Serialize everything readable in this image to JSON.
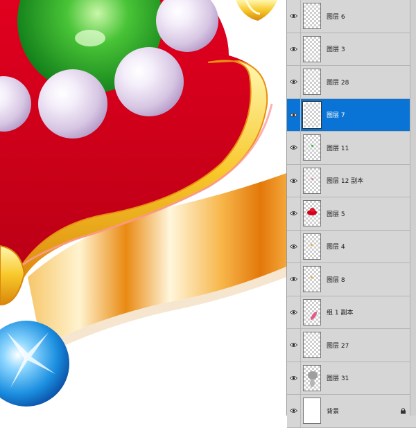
{
  "layers": [
    {
      "name": "图层 6",
      "selected": false,
      "thumb": "empty"
    },
    {
      "name": "图层 3",
      "selected": false,
      "thumb": "empty"
    },
    {
      "name": "图层 28",
      "selected": false,
      "thumb": "empty"
    },
    {
      "name": "图层 7",
      "selected": true,
      "thumb": "empty"
    },
    {
      "name": "图层 11",
      "selected": false,
      "thumb": "green-dot"
    },
    {
      "name": "图层 12 副本",
      "selected": false,
      "thumb": "pink-dot"
    },
    {
      "name": "图层 5",
      "selected": false,
      "thumb": "red-blob"
    },
    {
      "name": "图层 4",
      "selected": false,
      "thumb": "orange-dot"
    },
    {
      "name": "图层 8",
      "selected": false,
      "thumb": "orange-dot"
    },
    {
      "name": "组 1 副本",
      "selected": false,
      "thumb": "pink-streak"
    },
    {
      "name": "图层 27",
      "selected": false,
      "thumb": "empty"
    },
    {
      "name": "图层 31",
      "selected": false,
      "thumb": "gray-shape"
    },
    {
      "name": "背景",
      "selected": false,
      "thumb": "white",
      "locked": true
    }
  ],
  "colors": {
    "selection": "#0a74d6",
    "panel_bg": "#d6d6d6",
    "artwork_red": "#d4001c",
    "artwork_gold": "#f2b623"
  }
}
